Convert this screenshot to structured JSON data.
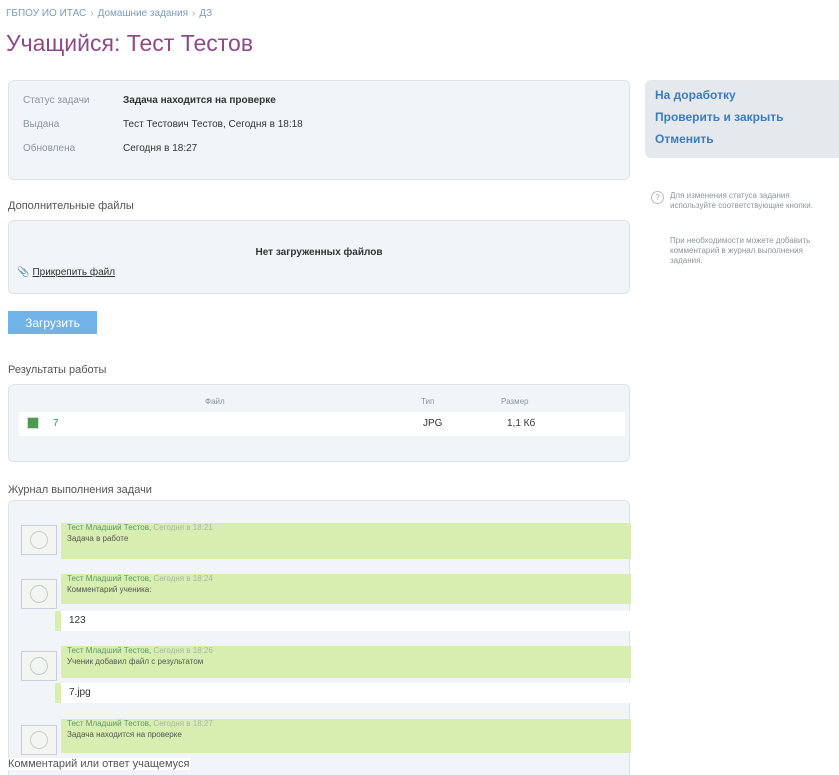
{
  "breadcrumb": [
    "ГБПОУ ИО ИТАС",
    "Домашние задания",
    "ДЗ"
  ],
  "page_title": "Учащийся: Тест Тестов",
  "info": {
    "status_label": "Статус задачи",
    "status_value": "Задача находится на проверке",
    "issued_label": "Выдана",
    "issued_value": "Тест Тестович Тестов, Сегодня в 18:18",
    "updated_label": "Обновлена",
    "updated_value": "Сегодня в 18:27"
  },
  "files": {
    "section_title": "Дополнительные файлы",
    "empty_text": "Нет загруженных файлов",
    "attach_label": "Прикрепить файл",
    "upload_button": "Загрузить"
  },
  "results": {
    "section_title": "Результаты работы",
    "columns": [
      "Файл",
      "Тип",
      "Размер"
    ],
    "rows": [
      {
        "file": "7",
        "type": "JPG",
        "size": "1,1 Кб"
      }
    ]
  },
  "journal": {
    "section_title": "Журнал выполнения задачи",
    "entries": [
      {
        "author": "Тест Младший Тестов",
        "time": "Сегодня в 18:21",
        "text": "Задача в работе",
        "answer": ""
      },
      {
        "author": "Тест Младший Тестов",
        "time": "Сегодня в 18:24",
        "text": "Комментарий ученика:",
        "answer": "123"
      },
      {
        "author": "Тест Младший Тестов",
        "time": "Сегодня в 18:26",
        "text": "Ученик добавил файл с результатом",
        "answer": "7.jpg"
      },
      {
        "author": "Тест Младший Тестов",
        "time": "Сегодня в 18:27",
        "text": "Задача находится на проверке",
        "answer": ""
      }
    ]
  },
  "comment_label": "Комментарий или ответ учащемуся",
  "actions": [
    "На доработку",
    "Проверить и закрыть",
    "Отменить"
  ],
  "hint": {
    "line1": "Для изменения статуса задания используйте соответствующие кнопки.",
    "line2": "При необходимости можете добавить комментарий в журнал выполнения задания."
  }
}
